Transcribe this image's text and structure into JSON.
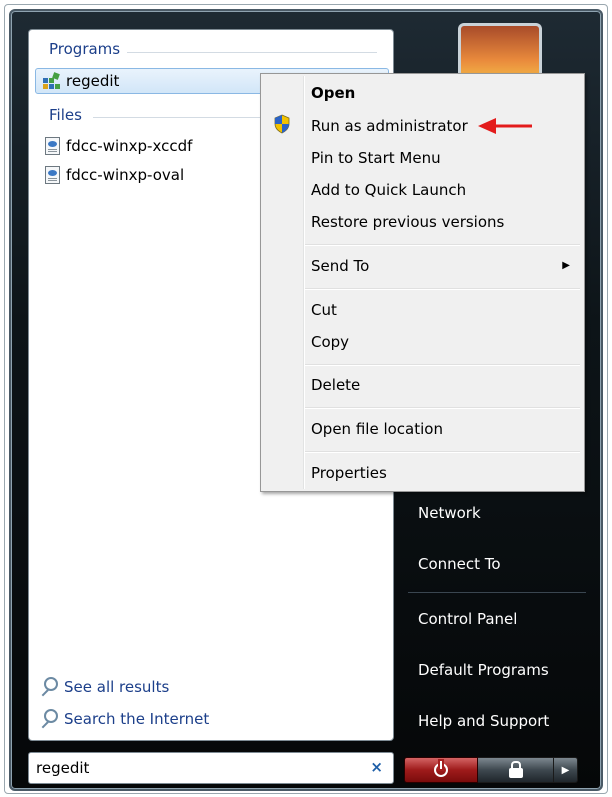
{
  "search_pane": {
    "programs_header": "Programs",
    "programs": [
      {
        "label": "regedit",
        "icon": "regedit-icon"
      }
    ],
    "files_header": "Files",
    "files": [
      {
        "label": "fdcc-winxp-xccdf",
        "icon": "document-icon"
      },
      {
        "label": "fdcc-winxp-oval",
        "icon": "document-icon"
      }
    ],
    "see_all_results": "See all results",
    "search_internet": "Search the Internet"
  },
  "search_box": {
    "value": "regedit",
    "clear_glyph": "×"
  },
  "context_menu": {
    "items": [
      {
        "label": "Open",
        "bold": true
      },
      {
        "label": "Run as administrator",
        "icon": "uac-shield-icon"
      },
      {
        "label": "Pin to Start Menu"
      },
      {
        "label": "Add to Quick Launch"
      },
      {
        "label": "Restore previous versions"
      },
      {
        "label": "Send To",
        "submenu": true
      },
      {
        "label": "Cut"
      },
      {
        "label": "Copy"
      },
      {
        "label": "Delete"
      },
      {
        "label": "Open file location"
      },
      {
        "label": "Properties"
      }
    ],
    "submenu_arrow": "▶"
  },
  "right_pane": {
    "items": [
      "Network",
      "Connect To",
      "Control Panel",
      "Default Programs",
      "Help and Support"
    ]
  },
  "power_buttons": {
    "power": "power-icon",
    "lock": "lock-icon",
    "arrow": "▶"
  },
  "colors": {
    "accent_link": "#1c3f8a",
    "annotation_arrow": "#e31b1b",
    "power_button": "#9e1b1b"
  }
}
